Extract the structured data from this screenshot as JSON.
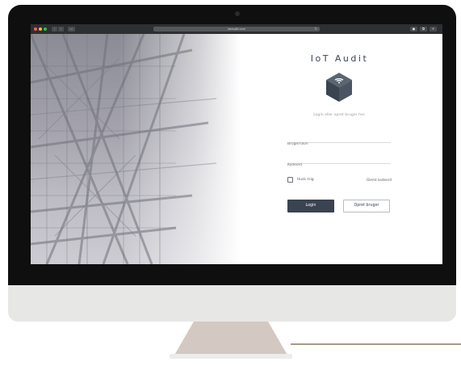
{
  "browser": {
    "url": "iotaudit.com",
    "traffic_lights": [
      "#ff5f57",
      "#febc2e",
      "#28c840"
    ],
    "icons": [
      "back-icon",
      "forward-icon",
      "sidebar-icon",
      "reload-icon",
      "share-icon",
      "tabs-icon",
      "add-tab-icon"
    ]
  },
  "login": {
    "title": "IoT Audit",
    "logo_icon": "wifi-cube-icon",
    "subtitle": "Login eller opret bruger her.",
    "username_placeholder": "Brugernavn",
    "password_placeholder": "Kodeord",
    "remember_label": "Husk mig",
    "forgot_label": "Glemt kodeord",
    "login_button": "Login",
    "register_button": "Opret bruger"
  },
  "colors": {
    "accent": "#3a4350",
    "bezel": "#0f0f10",
    "chin": "#e7e7e6",
    "stand": "#d4c8c2"
  }
}
